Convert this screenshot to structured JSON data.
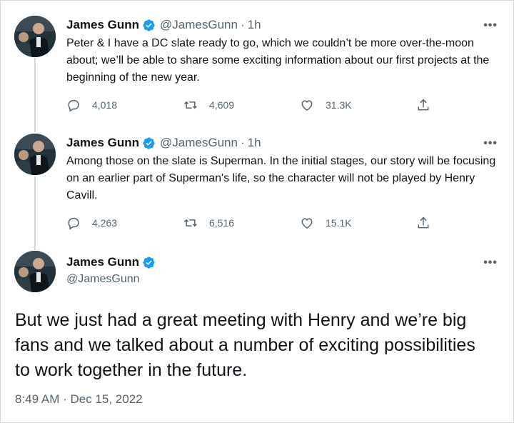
{
  "tweets": [
    {
      "name": "James Gunn",
      "handle": "@JamesGunn",
      "separator": "·",
      "time": "1h",
      "more": "•••",
      "text": "Peter & I have a DC slate ready to go, which we couldn’t be more over-the-moon about; we’ll be able to share some exciting information about our first projects at the beginning of the new year.",
      "replies": "4,018",
      "retweets": "4,609",
      "likes": "31.3K"
    },
    {
      "name": "James Gunn",
      "handle": "@JamesGunn",
      "separator": "·",
      "time": "1h",
      "more": "•••",
      "text": "Among those on the slate is Superman. In the initial stages, our story will be focusing on an earlier part of Superman's life, so the character will not be played by Henry Cavill.",
      "replies": "4,263",
      "retweets": "6,516",
      "likes": "15.1K"
    }
  ],
  "main_tweet": {
    "name": "James Gunn",
    "handle": "@JamesGunn",
    "more": "•••",
    "text": "But we just had a great meeting with Henry and we’re big fans and we talked about a number of exciting possibilities to work together in the future.",
    "timestamp": "8:49 AM · Dec 15, 2022"
  },
  "colors": {
    "verified": "#1d9bf0",
    "secondary_text": "#536471",
    "primary_text": "#0f1419",
    "thread_line": "#cfd9de"
  },
  "icons": {
    "reply": "reply-icon",
    "retweet": "retweet-icon",
    "like": "heart-icon",
    "share": "share-icon",
    "verified": "verified-badge-icon",
    "more": "more-icon"
  }
}
